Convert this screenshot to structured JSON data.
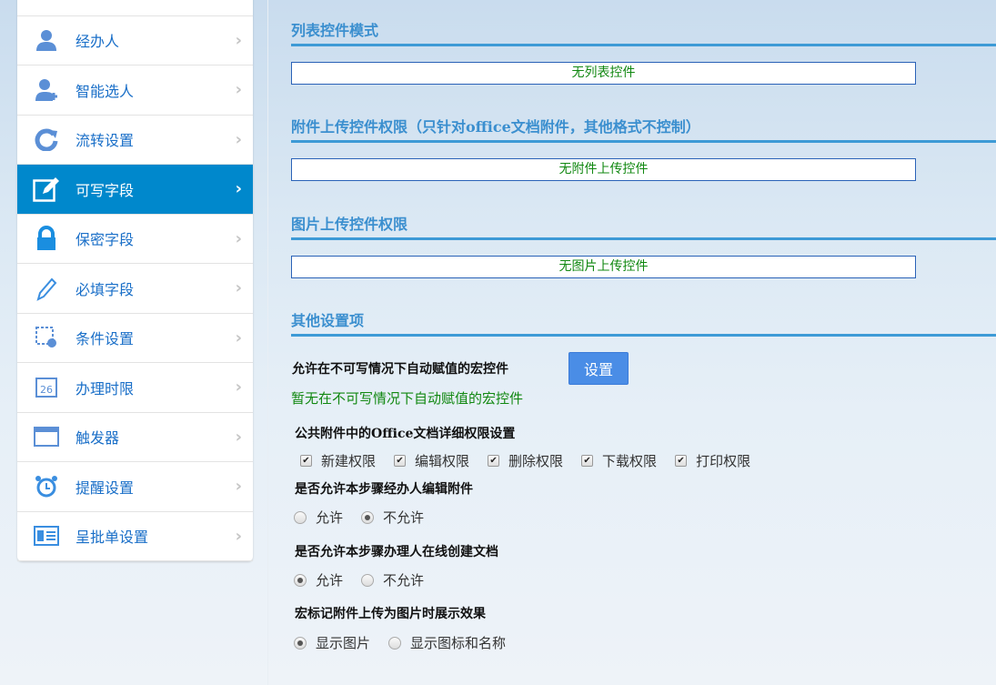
{
  "sidebar": {
    "items": [
      {
        "label": "",
        "icon": "gear-icon"
      },
      {
        "label": "经办人",
        "icon": "user-icon"
      },
      {
        "label": "智能选人",
        "icon": "user-add-icon"
      },
      {
        "label": "流转设置",
        "icon": "refresh-icon"
      },
      {
        "label": "可写字段",
        "icon": "edit-icon",
        "active": true
      },
      {
        "label": "保密字段",
        "icon": "lock-icon"
      },
      {
        "label": "必填字段",
        "icon": "pencil-icon"
      },
      {
        "label": "条件设置",
        "icon": "condition-icon"
      },
      {
        "label": "办理时限",
        "icon": "calendar-icon"
      },
      {
        "label": "触发器",
        "icon": "window-icon"
      },
      {
        "label": "提醒设置",
        "icon": "alarm-icon"
      },
      {
        "label": "呈批单设置",
        "icon": "form-icon"
      }
    ]
  },
  "sections": {
    "list": {
      "title": "列表控件模式",
      "value": "无列表控件"
    },
    "attach": {
      "title": "附件上传控件权限（只针对office文档附件，其他格式不控制）",
      "value": "无附件上传控件"
    },
    "image": {
      "title": "图片上传控件权限",
      "value": "无图片上传控件"
    },
    "other": {
      "title": "其他设置项"
    }
  },
  "other": {
    "macro_label": "允许在不可写情况下自动赋值的宏控件",
    "macro_button": "设置",
    "macro_empty": "暂无在不可写情况下自动赋值的宏控件",
    "office_label": "公共附件中的Office文档详细权限设置",
    "office_perms": [
      {
        "label": "新建权限",
        "checked": true
      },
      {
        "label": "编辑权限",
        "checked": true
      },
      {
        "label": "删除权限",
        "checked": true
      },
      {
        "label": "下载权限",
        "checked": true
      },
      {
        "label": "打印权限",
        "checked": true
      }
    ],
    "q1": {
      "label": "是否允许本步骤经办人编辑附件",
      "options": [
        "允许",
        "不允许"
      ],
      "selected": 1
    },
    "q2": {
      "label": "是否允许本步骤办理人在线创建文档",
      "options": [
        "允许",
        "不允许"
      ],
      "selected": 0
    },
    "q3": {
      "label": "宏标记附件上传为图片时展示效果",
      "options": [
        "显示图片",
        "显示图标和名称"
      ],
      "selected": 0
    }
  }
}
